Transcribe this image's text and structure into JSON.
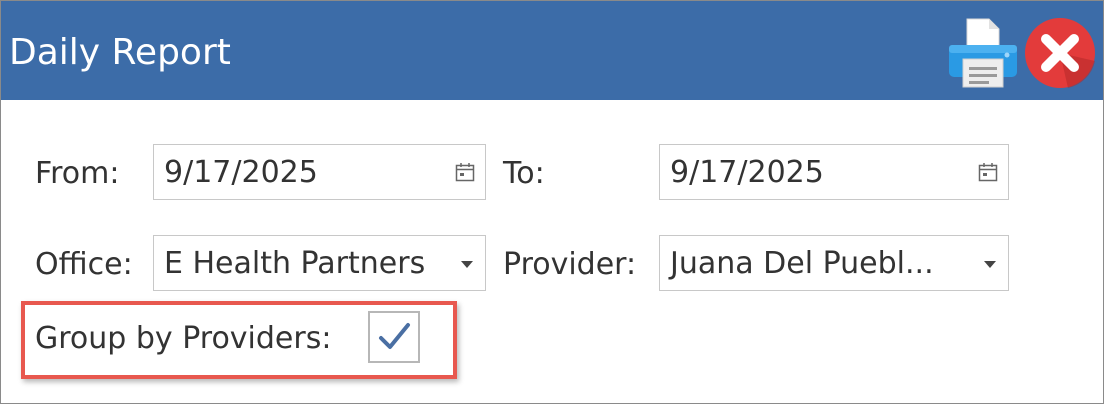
{
  "window": {
    "title": "Daily Report"
  },
  "toolbar": {
    "print_icon": "printer-icon",
    "close_icon": "close-icon"
  },
  "form": {
    "from_label": "From:",
    "from_value": "9/17/2025",
    "to_label": "To:",
    "to_value": "9/17/2025",
    "office_label": "Office:",
    "office_value": "E Health Partners",
    "provider_label": "Provider:",
    "provider_value": "Juana Del Puebl...",
    "group_label": "Group by Providers:",
    "group_checked": true
  },
  "colors": {
    "titlebar": "#3c6ca8",
    "close_button": "#e33b3b",
    "highlight": "#e8584f",
    "checkmark": "#4a6fa3"
  }
}
